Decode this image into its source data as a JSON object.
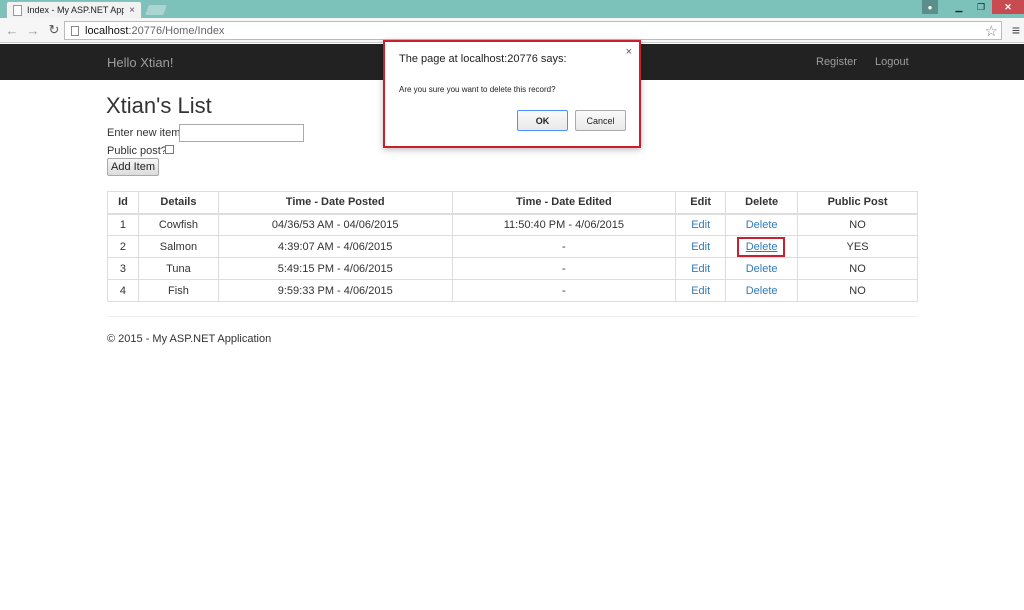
{
  "browser": {
    "tab_title": "Index - My ASP.NET Applic",
    "tab_close": "×",
    "url_host": "localhost",
    "url_rest": ":20776/Home/Index",
    "win_minimize": "▁",
    "win_restore": "❐",
    "win_close": "✕"
  },
  "navbar": {
    "brand": "Hello Xtian!",
    "register": "Register",
    "logout": "Logout"
  },
  "page": {
    "title": "Xtian's List",
    "new_item_label": "Enter new item:",
    "public_label": "Public post?",
    "add_button": "Add Item"
  },
  "table": {
    "headers": [
      "Id",
      "Details",
      "Time - Date Posted",
      "Time - Date Edited",
      "Edit",
      "Delete",
      "Public Post"
    ],
    "rows": [
      {
        "id": "1",
        "details": "Cowfish",
        "posted": "04/36/53 AM - 04/06/2015",
        "edited": "11:50:40 PM - 4/06/2015",
        "edit": "Edit",
        "delete": "Delete",
        "public": "NO"
      },
      {
        "id": "2",
        "details": "Salmon",
        "posted": "4:39:07 AM - 4/06/2015",
        "edited": "-",
        "edit": "Edit",
        "delete": "Delete",
        "public": "YES"
      },
      {
        "id": "3",
        "details": "Tuna",
        "posted": "5:49:15 PM - 4/06/2015",
        "edited": "-",
        "edit": "Edit",
        "delete": "Delete",
        "public": "NO"
      },
      {
        "id": "4",
        "details": "Fish",
        "posted": "9:59:33 PM - 4/06/2015",
        "edited": "-",
        "edit": "Edit",
        "delete": "Delete",
        "public": "NO"
      }
    ]
  },
  "footer": "© 2015 - My ASP.NET Application",
  "dialog": {
    "title": "The page at localhost:20776 says:",
    "close": "×",
    "message": "Are you sure you want to delete this record?",
    "ok": "OK",
    "cancel": "Cancel"
  },
  "colors": {
    "navbar_bg": "#222222",
    "link": "#337ab7",
    "highlight": "#c8202f"
  }
}
